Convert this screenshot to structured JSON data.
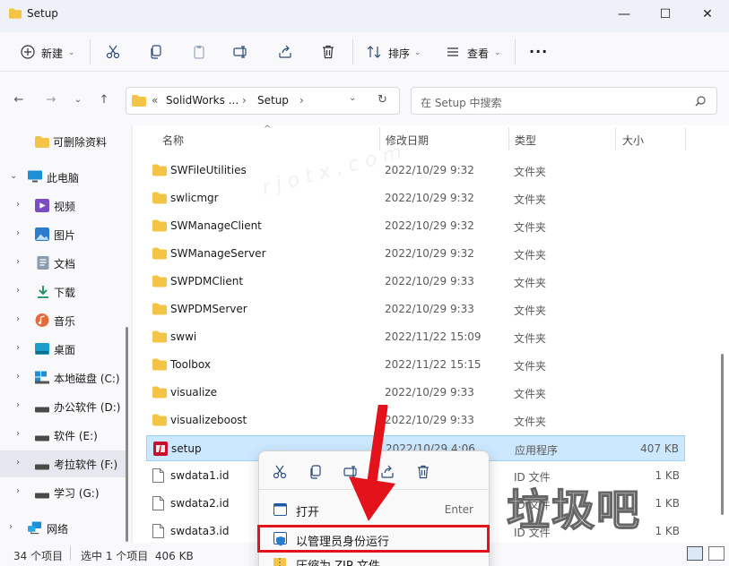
{
  "window": {
    "title": "Setup",
    "controls": {
      "minimize": "—",
      "maximize": "☐",
      "close": "✕"
    }
  },
  "toolbar": {
    "new_label": "新建",
    "sort_label": "排序",
    "view_label": "查看",
    "more_label": "···"
  },
  "navigation": {
    "breadcrumb": {
      "overflow": "«",
      "parent": "SolidWorks ...",
      "current": "Setup"
    },
    "search_placeholder": "在 Setup 中搜索"
  },
  "sidebar": {
    "items": [
      {
        "label": "可删除资料",
        "icon": "folder-icon"
      },
      {
        "label": "此电脑",
        "icon": "pc-icon"
      },
      {
        "label": "视频",
        "icon": "video-icon"
      },
      {
        "label": "图片",
        "icon": "picture-icon"
      },
      {
        "label": "文档",
        "icon": "document-icon"
      },
      {
        "label": "下载",
        "icon": "download-icon"
      },
      {
        "label": "音乐",
        "icon": "music-icon"
      },
      {
        "label": "桌面",
        "icon": "desktop-icon"
      },
      {
        "label": "本地磁盘 (C:)",
        "icon": "drive-icon"
      },
      {
        "label": "办公软件 (D:)",
        "icon": "drive-icon"
      },
      {
        "label": "软件 (E:)",
        "icon": "drive-icon"
      },
      {
        "label": "考拉软件 (F:)",
        "icon": "drive-icon"
      },
      {
        "label": "学习 (G:)",
        "icon": "drive-icon"
      },
      {
        "label": "网络",
        "icon": "network-icon"
      }
    ]
  },
  "file_list": {
    "columns": {
      "name": "名称",
      "modified": "修改日期",
      "type": "类型",
      "size": "大小"
    },
    "rows": [
      {
        "name": "SWFileUtilities",
        "modified": "2022/10/29 9:32",
        "type": "文件夹",
        "size": ""
      },
      {
        "name": "swlicmgr",
        "modified": "2022/10/29 9:32",
        "type": "文件夹",
        "size": ""
      },
      {
        "name": "SWManageClient",
        "modified": "2022/10/29 9:32",
        "type": "文件夹",
        "size": ""
      },
      {
        "name": "SWManageServer",
        "modified": "2022/10/29 9:32",
        "type": "文件夹",
        "size": ""
      },
      {
        "name": "SWPDMClient",
        "modified": "2022/10/29 9:33",
        "type": "文件夹",
        "size": ""
      },
      {
        "name": "SWPDMServer",
        "modified": "2022/10/29 9:33",
        "type": "文件夹",
        "size": ""
      },
      {
        "name": "swwi",
        "modified": "2022/11/22 15:09",
        "type": "文件夹",
        "size": ""
      },
      {
        "name": "Toolbox",
        "modified": "2022/11/22 15:15",
        "type": "文件夹",
        "size": ""
      },
      {
        "name": "visualize",
        "modified": "2022/10/29 9:33",
        "type": "文件夹",
        "size": ""
      },
      {
        "name": "visualizeboost",
        "modified": "2022/10/29 9:33",
        "type": "文件夹",
        "size": ""
      },
      {
        "name": "setup",
        "modified": "2022/10/29 4:06",
        "type": "应用程序",
        "size": "407 KB"
      },
      {
        "name": "swdata1.id",
        "modified": "",
        "type": "ID 文件",
        "size": "1 KB"
      },
      {
        "name": "swdata2.id",
        "modified": "",
        "type": "ID 文件",
        "size": "1 KB"
      },
      {
        "name": "swdata3.id",
        "modified": "",
        "type": "ID 文件",
        "size": "1 KB"
      }
    ]
  },
  "status_bar": {
    "item_count": "34 个项目",
    "selection": "选中 1 个项目  406 KB"
  },
  "context_menu": {
    "open_label": "打开",
    "open_shortcut": "Enter",
    "run_as_admin_label": "以管理员身份运行",
    "compress_label": "压缩为 ZIP 文件"
  },
  "watermark": {
    "text": "垃圾吧",
    "site": "r j o t x . c o m"
  },
  "colors": {
    "folder": "#f3c445",
    "selection": "#cce8ff",
    "accent": "#0067c0",
    "highlight_box": "#e3121b"
  }
}
